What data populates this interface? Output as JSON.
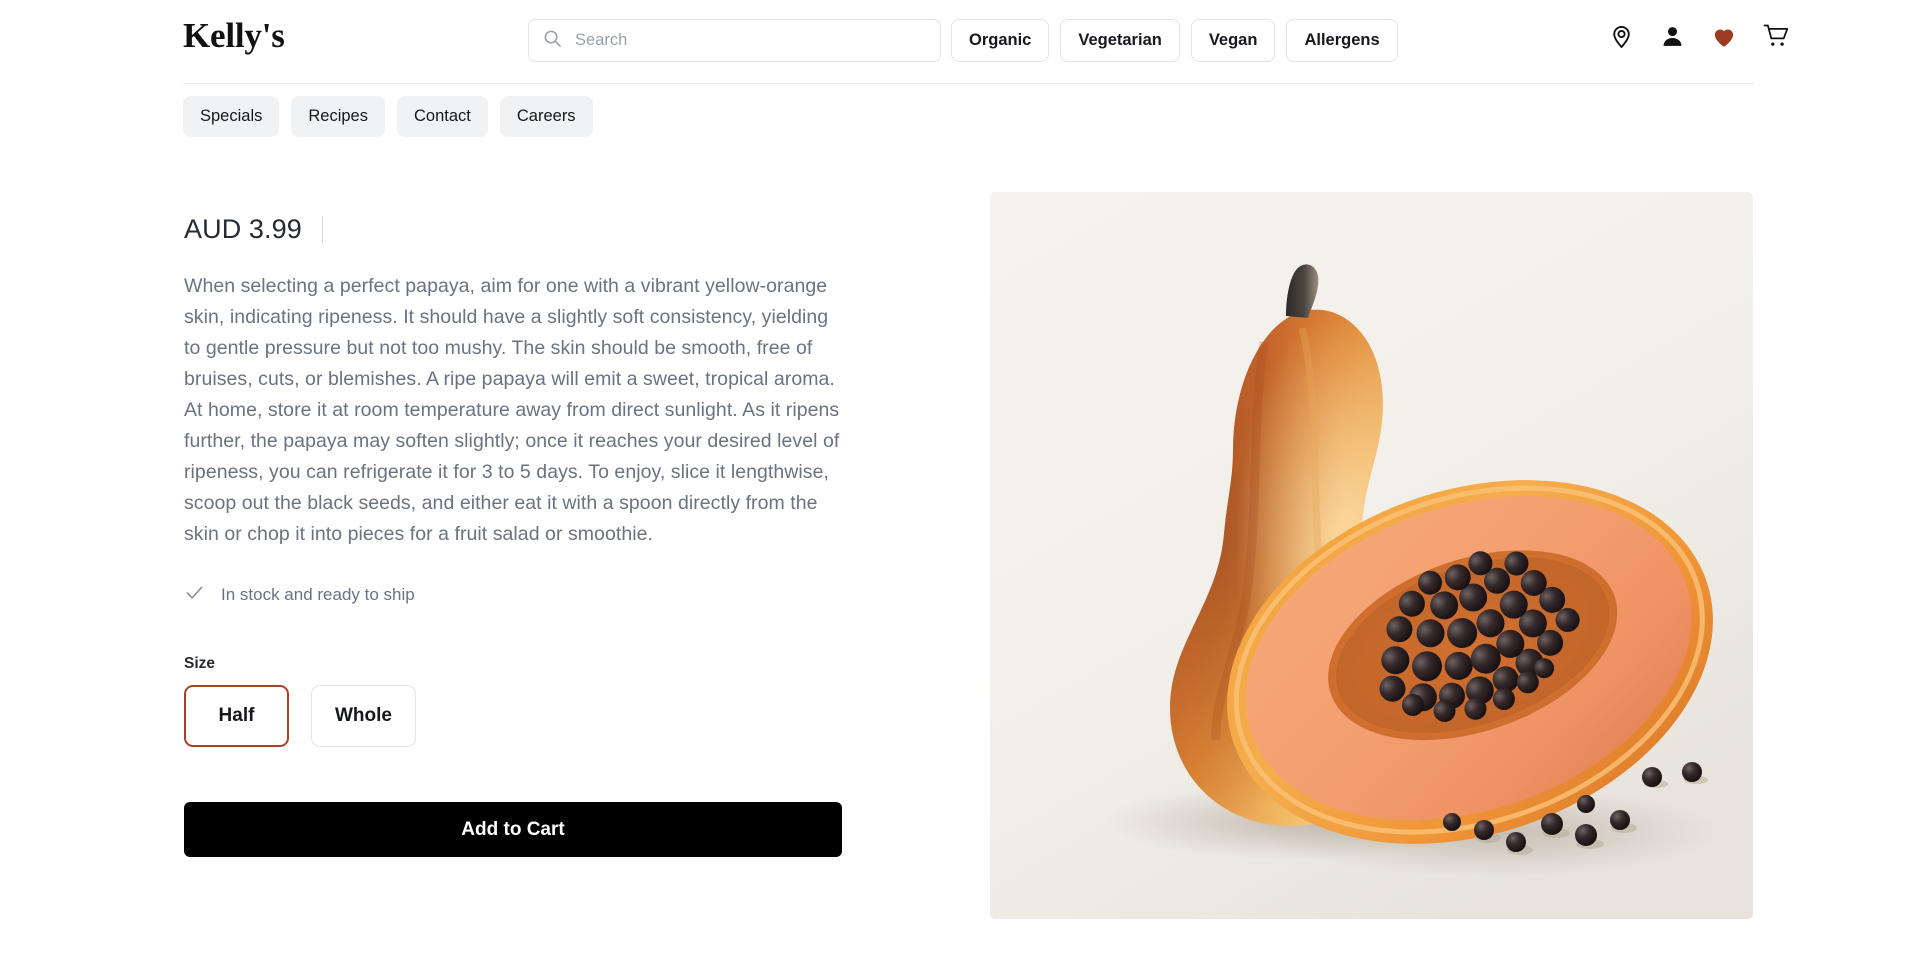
{
  "header": {
    "logo": "Kelly's",
    "search": {
      "placeholder": "Search",
      "value": "",
      "icon": "search-icon"
    },
    "filters": [
      {
        "label": "Organic"
      },
      {
        "label": "Vegetarian"
      },
      {
        "label": "Vegan"
      },
      {
        "label": "Allergens"
      }
    ],
    "icons": [
      {
        "name": "location-pin-icon"
      },
      {
        "name": "user-account-icon"
      },
      {
        "name": "heart-wishlist-icon",
        "color": "#9c3a22"
      },
      {
        "name": "shopping-cart-icon"
      }
    ]
  },
  "subnav": {
    "items": [
      {
        "label": "Specials"
      },
      {
        "label": "Recipes"
      },
      {
        "label": "Contact"
      },
      {
        "label": "Careers"
      }
    ]
  },
  "product": {
    "price": "AUD 3.99",
    "description": "When selecting a perfect papaya, aim for one with a vibrant yellow-orange skin, indicating ripeness. It should have a slightly soft consistency, yielding to gentle pressure but not too mushy. The skin should be smooth, free of bruises, cuts, or blemishes. A ripe papaya will emit a sweet, tropical aroma. At home, store it at room temperature away from direct sunlight. As it ripens further, the papaya may soften slightly; once it reaches your desired level of ripeness, you can refrigerate it for 3 to 5 days. To enjoy, slice it lengthwise, scoop out the black seeds, and either eat it with a spoon directly from the skin or chop it into pieces for a fruit salad or smoothie.",
    "stock_status": "In stock and ready to ship",
    "stock_icon": "check-icon",
    "size": {
      "label": "Size",
      "options": [
        {
          "label": "Half",
          "selected": true
        },
        {
          "label": "Whole",
          "selected": false
        }
      ]
    },
    "add_to_cart_label": "Add to Cart",
    "image_alt": "papaya-product-photo"
  },
  "colors": {
    "accent_rust": "#a8432a",
    "heart_red": "#9c3a22",
    "cart_button": "#000000",
    "body_text": "#6b7280",
    "image_background": "#f3f0ec"
  }
}
